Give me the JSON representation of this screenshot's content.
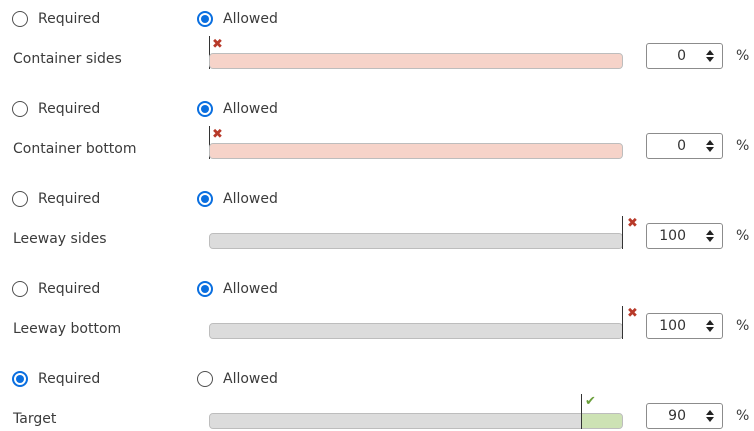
{
  "rows": [
    {
      "required_label": "Required",
      "allowed_label": "Allowed",
      "selected": "allowed",
      "label": "Container sides",
      "value": "0",
      "unit": "%",
      "level_fraction": 0.0,
      "status": "x-icon"
    },
    {
      "required_label": "Required",
      "allowed_label": "Allowed",
      "selected": "allowed",
      "label": "Container bottom",
      "value": "0",
      "unit": "%",
      "level_fraction": 0.0,
      "status": "x-icon"
    },
    {
      "required_label": "Required",
      "allowed_label": "Allowed",
      "selected": "allowed",
      "label": "Leeway sides",
      "value": "100",
      "unit": "%",
      "level_fraction": 1.0,
      "status": "x-icon"
    },
    {
      "required_label": "Required",
      "allowed_label": "Allowed",
      "selected": "allowed",
      "label": "Leeway bottom",
      "value": "100",
      "unit": "%",
      "level_fraction": 1.0,
      "status": "x-icon"
    },
    {
      "required_label": "Required",
      "allowed_label": "Allowed",
      "selected": "required",
      "label": "Target",
      "value": "90",
      "unit": "%",
      "level_fraction": 0.9,
      "status": "check-icon"
    }
  ],
  "colors": {
    "accent": "#0a6fe0",
    "bad": "#f6d3c9",
    "good": "#cde2b4",
    "track": "#dcdcdc",
    "x_icon": "#b83a2a",
    "check_icon": "#6a9f3a"
  }
}
